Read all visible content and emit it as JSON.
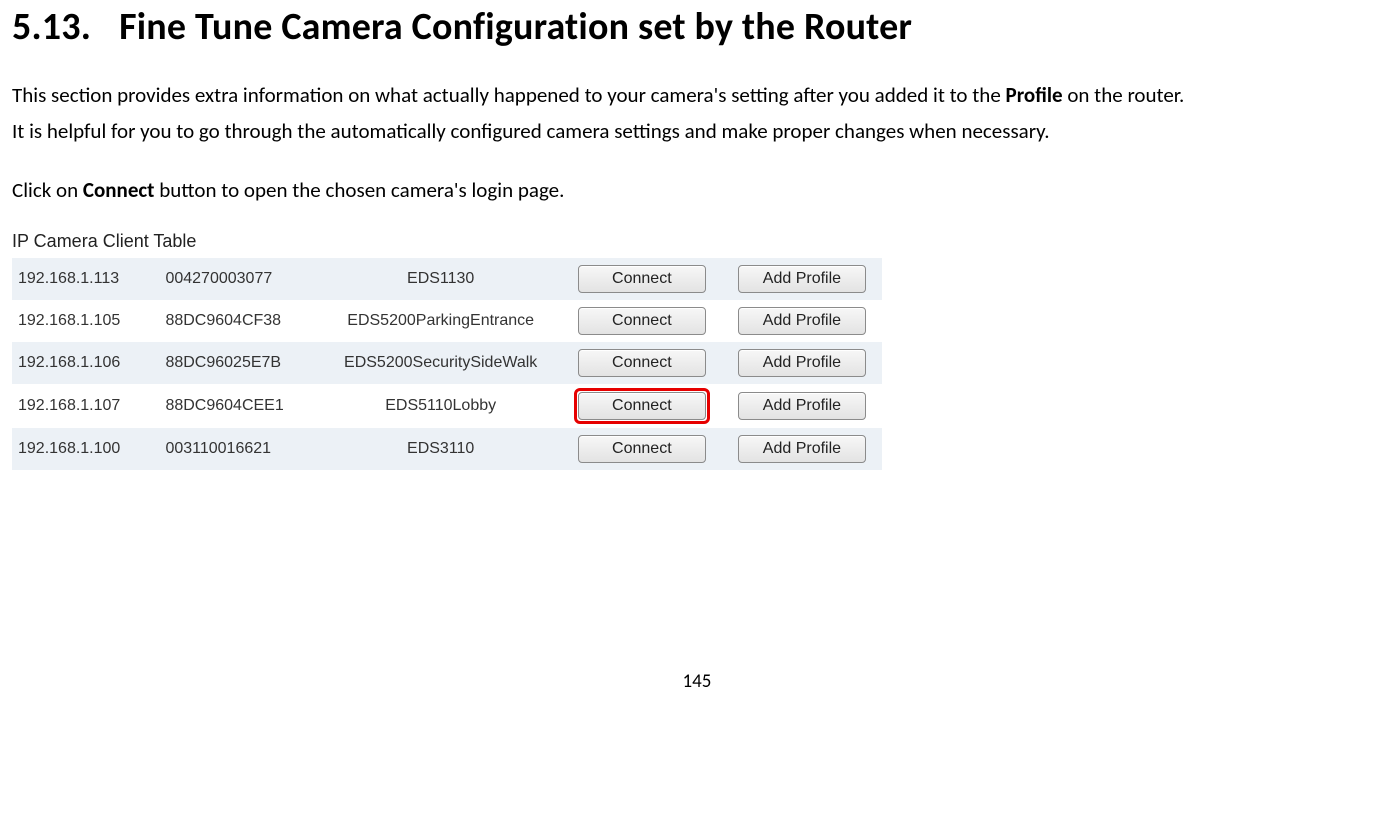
{
  "heading": {
    "number": "5.13.",
    "title": "Fine Tune Camera Configuration set by the Router"
  },
  "paragraphs": {
    "p1_a": "This section provides extra information on what actually happened to your camera's setting after you added it to the ",
    "p1_bold": "Profile",
    "p1_b": " on the router.",
    "p2": "It is helpful for you to go through the automatically configured camera settings and make proper changes when necessary.",
    "p3_a": "Click on ",
    "p3_bold": "Connect",
    "p3_b": " button to open the chosen camera's login page."
  },
  "table": {
    "title": "IP Camera Client Table",
    "connect_label": "Connect",
    "add_profile_label": "Add Profile",
    "rows": [
      {
        "ip": "192.168.1.113",
        "mac": "004270003077",
        "name": "EDS1130",
        "highlight": false
      },
      {
        "ip": "192.168.1.105",
        "mac": "88DC9604CF38",
        "name": "EDS5200ParkingEntrance",
        "highlight": false
      },
      {
        "ip": "192.168.1.106",
        "mac": "88DC96025E7B",
        "name": "EDS5200SecuritySideWalk",
        "highlight": false
      },
      {
        "ip": "192.168.1.107",
        "mac": "88DC9604CEE1",
        "name": "EDS5110Lobby",
        "highlight": true
      },
      {
        "ip": "192.168.1.100",
        "mac": "003110016621",
        "name": "EDS3110",
        "highlight": false
      }
    ]
  },
  "page_number": "145"
}
